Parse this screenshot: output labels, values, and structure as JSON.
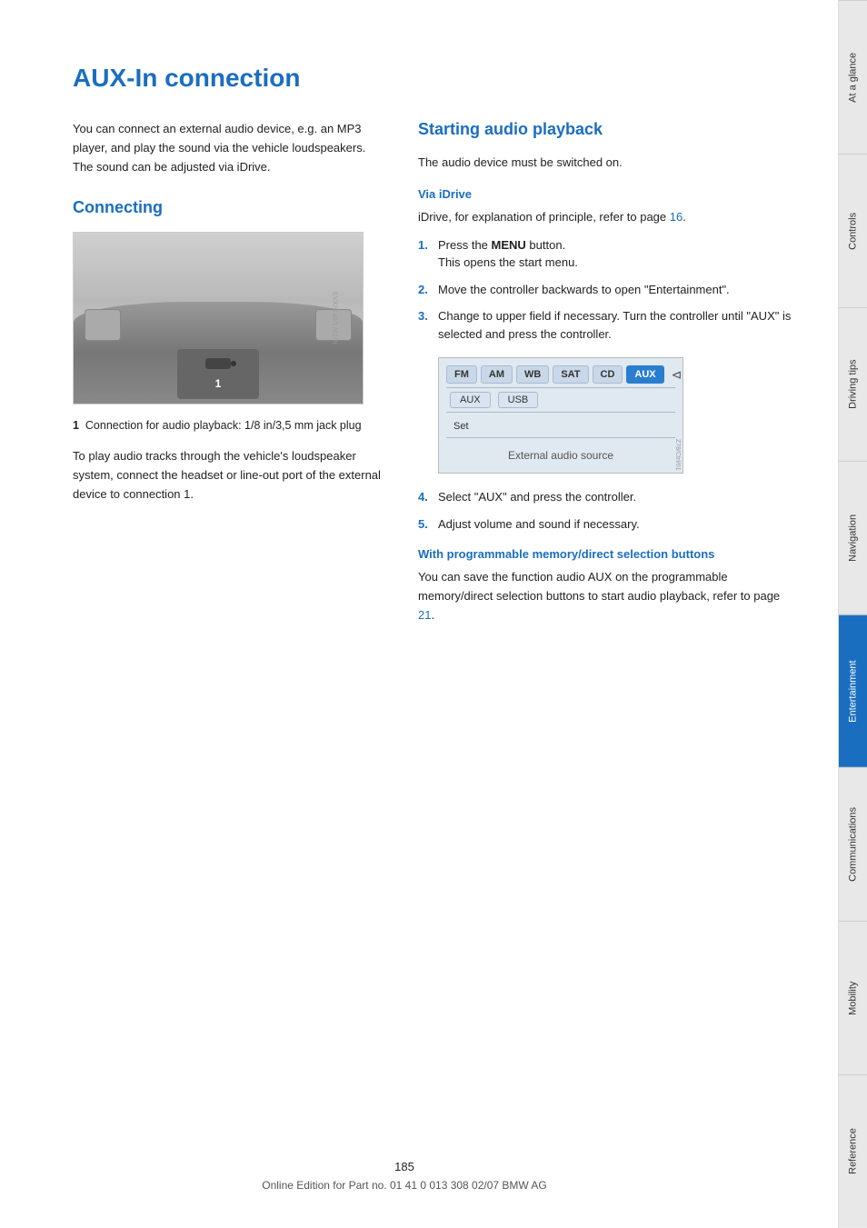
{
  "page": {
    "title": "AUX-In connection",
    "page_number": "185",
    "footer_text": "Online Edition for Part no. 01 41 0 013 308 02/07 BMW AG"
  },
  "sidebar": {
    "tabs": [
      {
        "label": "At a glance",
        "active": false
      },
      {
        "label": "Controls",
        "active": false
      },
      {
        "label": "Driving tips",
        "active": false
      },
      {
        "label": "Navigation",
        "active": false
      },
      {
        "label": "Entertainment",
        "active": true
      },
      {
        "label": "Communications",
        "active": false
      },
      {
        "label": "Mobility",
        "active": false
      },
      {
        "label": "Reference",
        "active": false
      }
    ]
  },
  "left_section": {
    "heading": "Connecting",
    "intro": "You can connect an external audio device, e.g. an MP3 player, and play the sound via the vehicle loudspeakers. The sound can be adjusted via iDrive.",
    "image_label_number": "1",
    "image_watermark": "EVX/Cab/L/02/N",
    "caption_number": "1",
    "caption_text": "Connection for audio playback: 1/8 in/3,5 mm jack plug",
    "body_text": "To play audio tracks through the vehicle's loudspeaker system, connect the headset or line-out port of the external device to connection 1."
  },
  "right_section": {
    "heading": "Starting audio playback",
    "intro": "The audio device must be switched on.",
    "via_idrive": {
      "subheading": "Via iDrive",
      "intro": "iDrive, for explanation of principle, refer to page 16.",
      "steps": [
        {
          "number": "1.",
          "text_before": "Press the ",
          "bold": "MENU",
          "text_after": " button.",
          "sub_text": "This opens the start menu."
        },
        {
          "number": "2.",
          "text": "Move the controller backwards to open \"Entertainment\"."
        },
        {
          "number": "3.",
          "text": "Change to upper field if necessary. Turn the controller until \"AUX\" is selected and press the controller."
        },
        {
          "number": "4.",
          "text": "Select \"AUX\" and press the controller."
        },
        {
          "number": "5.",
          "text": "Adjust volume and sound if necessary."
        }
      ]
    },
    "screen": {
      "tabs": [
        "FM",
        "AM",
        "WB",
        "SAT",
        "CD",
        "AUX"
      ],
      "active_tab": "AUX",
      "sub_items": [
        "AUX",
        "USB"
      ],
      "set_label": "Set",
      "ext_label": "External audio source",
      "watermark": "Z78/Ctrl/61"
    },
    "programmable_section": {
      "subheading": "With programmable memory/direct selection buttons",
      "text": "You can save the function audio AUX on the programmable memory/direct selection buttons to start audio playback, refer to page 21."
    }
  }
}
